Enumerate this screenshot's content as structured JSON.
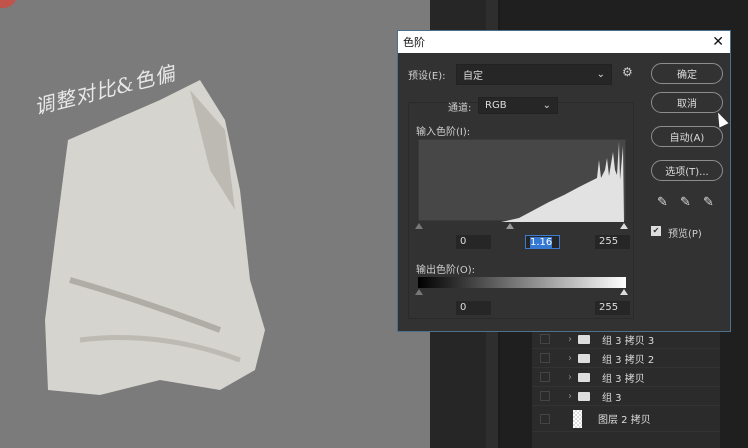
{
  "canvas": {
    "note": "调整对比&色偏"
  },
  "layers": [
    {
      "name": "组 3 拷贝 3",
      "type": "folder"
    },
    {
      "name": "组 3 拷贝 2",
      "type": "folder"
    },
    {
      "name": "组 3 拷贝",
      "type": "folder"
    },
    {
      "name": "组 3",
      "type": "folder"
    },
    {
      "name": "图层 2 拷贝",
      "type": "layer"
    }
  ],
  "dialog": {
    "title": "色阶",
    "preset_label": "预设(E):",
    "preset_value": "自定",
    "channel_label": "通道:",
    "channel_value": "RGB",
    "input_label": "输入色阶(I):",
    "input_black": "0",
    "input_gamma": "1.16",
    "input_white": "255",
    "output_label": "输出色阶(O):",
    "output_black": "0",
    "output_white": "255",
    "buttons": {
      "ok": "确定",
      "cancel": "取消",
      "auto": "自动(A)",
      "options": "选项(T)..."
    },
    "preview_label": "预览(P)",
    "preview_checked": true
  }
}
